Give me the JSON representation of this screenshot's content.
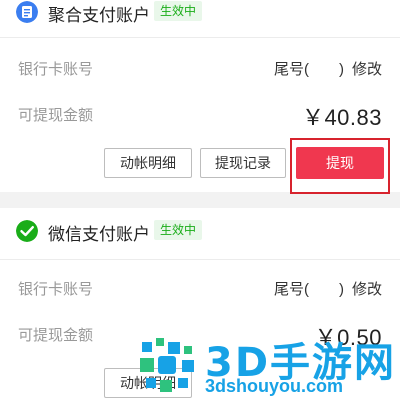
{
  "accounts": [
    {
      "title": "聚合支付账户",
      "status": "生效中",
      "icon": "aggregate-pay-icon",
      "icon_color": "#3b7ef0",
      "bank_label": "银行卡账号",
      "tail_label": "尾号(　　)",
      "modify_label": "修改",
      "amount_label": "可提现金额",
      "amount": "￥40.83",
      "buttons": {
        "detail": "动帐明细",
        "records": "提现记录",
        "withdraw": "提现"
      }
    },
    {
      "title": "微信支付账户",
      "status": "生效中",
      "icon": "wechat-pay-icon",
      "icon_color": "#1aad19",
      "bank_label": "银行卡账号",
      "tail_label": "尾号(　　)",
      "modify_label": "修改",
      "amount_label": "可提现金额",
      "amount": "￥0.50",
      "buttons": {
        "detail": "动帐明细"
      }
    }
  ],
  "watermark": {
    "brand": "3D手游网",
    "url": "3dshouyou.com"
  },
  "colors": {
    "accent": "#f0374f",
    "highlight": "#d7232d",
    "status": "#1aad19",
    "watermark": "#17a2e6"
  }
}
